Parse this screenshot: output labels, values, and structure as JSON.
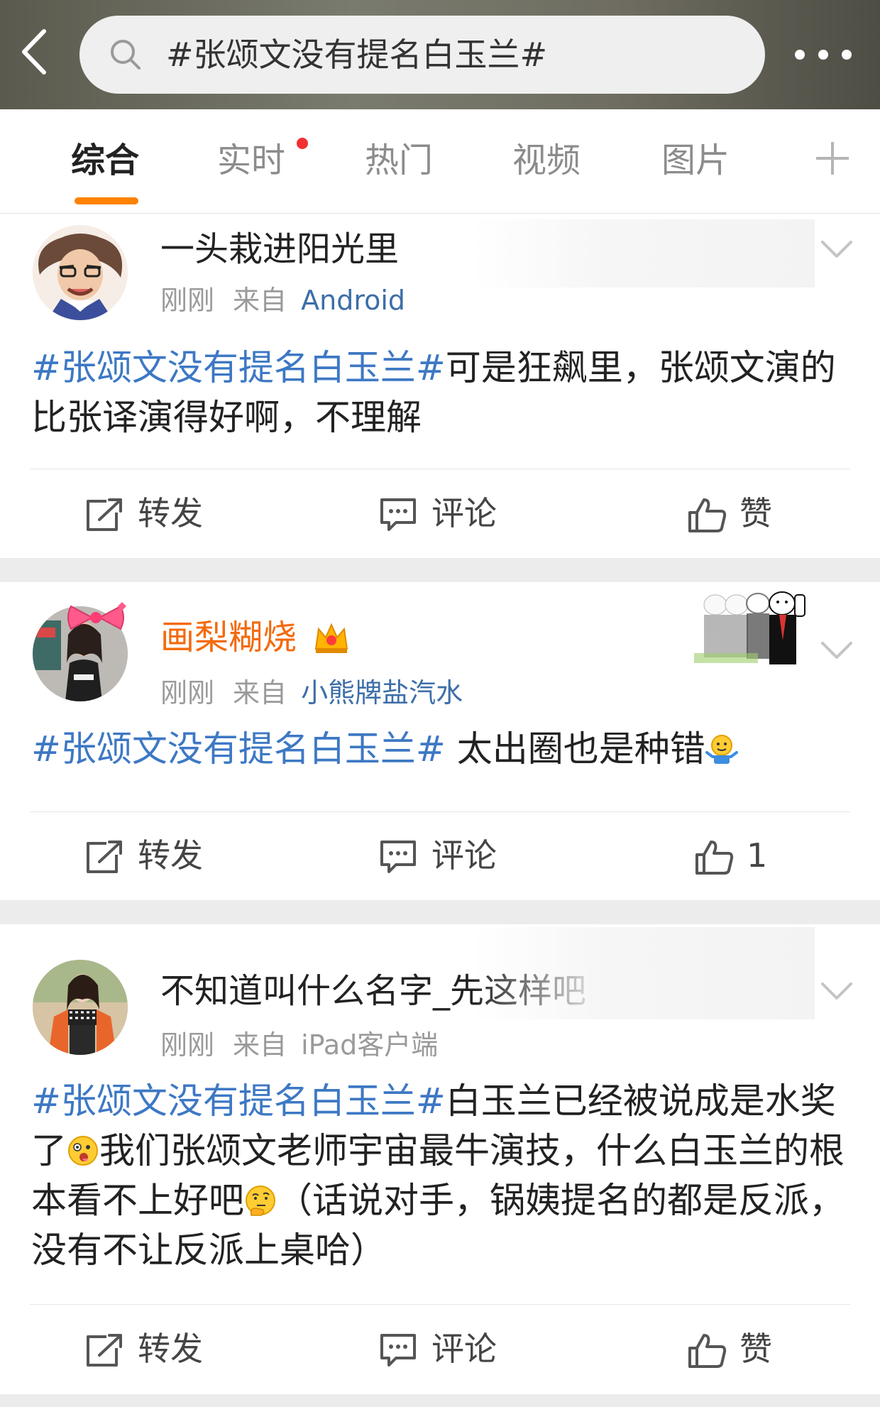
{
  "search": {
    "query": "#张颂文没有提名白玉兰#"
  },
  "tabs": [
    {
      "label": "综合",
      "active": true
    },
    {
      "label": "实时",
      "has_dot": true
    },
    {
      "label": "热门"
    },
    {
      "label": "视频"
    },
    {
      "label": "图片"
    }
  ],
  "colors": {
    "accent": "#ff8200",
    "topic": "#3d78c4",
    "vip_name": "#f46a0c",
    "source_link": "#3d6ea8",
    "badge_dot": "#f23030"
  },
  "posts": [
    {
      "user": "一头栽进阳光里",
      "time": "刚刚",
      "source_prefix": "来自",
      "source": "Android",
      "topic": "#张颂文没有提名白玉兰#",
      "text_1": "可是狂飙里，张颂文演的比张译演得好啊，不理解",
      "actions": {
        "repost": "转发",
        "comment": "评论",
        "like": "赞"
      }
    },
    {
      "user": "画梨糊烧",
      "time": "刚刚",
      "source_prefix": "来自",
      "source": "小熊牌盐汽水",
      "topic": "#张颂文没有提名白玉兰#",
      "text_1": " 太出圈也是种错",
      "actions": {
        "repost": "转发",
        "comment": "评论",
        "like": "1"
      }
    },
    {
      "user": "不知道叫什么名字_先这样吧",
      "time": "刚刚",
      "source_prefix": "来自",
      "source": "iPad客户端",
      "topic": "#张颂文没有提名白玉兰#",
      "text_1": "白玉兰已经被说成是水奖了",
      "text_2": "我们张颂文老师宇宙最牛演技，什么白玉兰的根本看不上好吧",
      "text_3": "（话说对手，锅姨提名的都是反派，没有不让反派上桌哈）",
      "actions": {
        "repost": "转发",
        "comment": "评论",
        "like": "赞"
      }
    }
  ]
}
